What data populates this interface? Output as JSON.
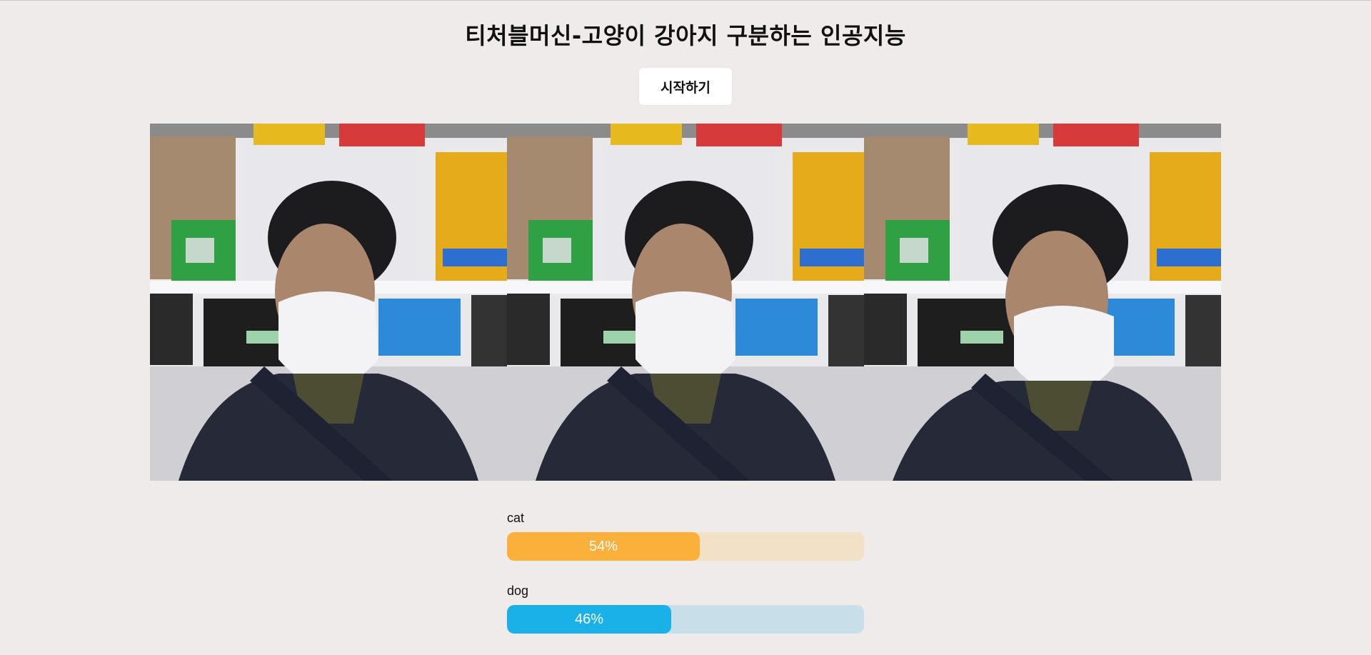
{
  "page": {
    "title": "티처블머신-고양이 강아지 구분하는 인공지능",
    "start_label": "시작하기"
  },
  "webcam": {
    "frames": 3
  },
  "results": [
    {
      "label": "cat",
      "value_text": "54%",
      "value": 0.54,
      "fill_color": "#fbb03b",
      "track_color": "#f2e0c7"
    },
    {
      "label": "dog",
      "value_text": "46%",
      "value": 0.46,
      "fill_color": "#1ab0e8",
      "track_color": "#c8dfea"
    }
  ]
}
